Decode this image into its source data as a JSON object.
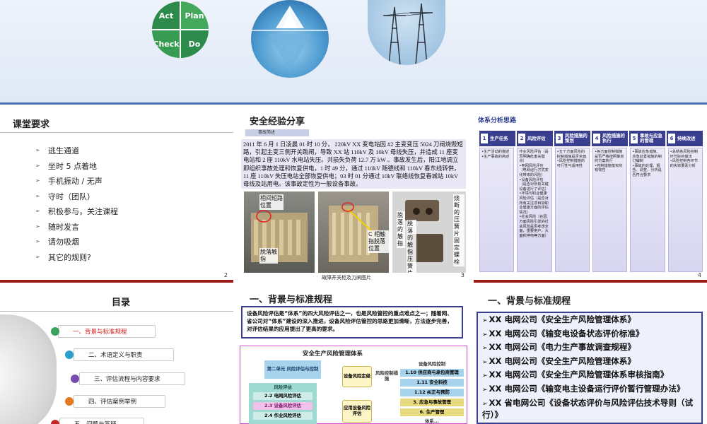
{
  "banner": {
    "pdca": {
      "act": "Act",
      "plan": "Plan",
      "check": "Check",
      "do": "Do"
    }
  },
  "slide1": {
    "title": "课堂要求",
    "items": [
      "逃生通道",
      "坐时 5 点着地",
      "手机振动 / 无声",
      "守时（团队）",
      "积极参与，关注课程",
      "随时发言",
      "请勿吸烟",
      "其它的规则?"
    ],
    "page": "2"
  },
  "slide2": {
    "title": "安全经验分享",
    "tag": "事故简述",
    "story": "2011 年 6 月 1 日凌晨 01 时 10 分， 220kV XX 变电站因 #2 主变变压 5024 刀闸烧毁短路，引起主变三侧开关跳闸，导致 XX 站 110kV 及 10kV 母线失压，并造成 11 座变电站和 2 座 110kV 水电站失压。共损失负荷 12.7 万 kW 。事故发生后，阳江地调立即组织事故处理和恢复供电，1 时 49 分，通过 110kV 随德线和 110kV 春东线转供， 11 座 110kV 失压电站全部恢复供电；03 时 01 分通过 10kV 联络线恢复春城站 10kV 母线及站用电。该事故定性为一般设备事故。",
    "photo_labels": {
      "a1": "相间短路位置",
      "a2": "脱落触指",
      "b1": "C 相触指脱落位置",
      "c1": "烧断的压簧片固定螺栓",
      "c2": "脱落的触指",
      "c3": "脱落的触指压簧片"
    },
    "caption": "故障开关柜及刀闸图片",
    "page": "3"
  },
  "slide3": {
    "title": "体系分析思路",
    "steps": [
      {
        "n": "1",
        "label": "生产任务"
      },
      {
        "n": "2",
        "label": "风险评估"
      },
      {
        "n": "3",
        "label": "风险措施的策划"
      },
      {
        "n": "4",
        "label": "风险措施的执行"
      },
      {
        "n": "5",
        "label": "事故与应急的管理"
      },
      {
        "n": "6",
        "label": "持续改进"
      }
    ],
    "columns": [
      "•生产活动的描述\n•生产事故的简述",
      "作业风险评估（是否明确危害关键点）\n•电网风险评估（电网运行方式变化带来的风险）\n•设备风险评估（是否对所有关键设备进行了评估）\n•环境与职业健康风险评估（是否对所有关注项目如职业健康方面的评估情况）\n•社会风险（在因方面风险引发的社会风险是否考虑全面，重要用户，大面积停电等方面）",
      "•五个方面风险的控制措施是否全面\n•风险控制措施的可行性与适用性",
      "•各方面控制措施是否严格按照策划的方案执行\n•控制措施落实的有效性",
      "•事故应急措施、应急处置措施的制订编制\n•事故的处理、报告、调查、分析是否符合要求",
      "•总结各风险控制环节好的做法\n•风险控制各环节的失效要素分析"
    ],
    "page": "4"
  },
  "slide4": {
    "title": "目录",
    "items": [
      "一、背景与标准规程",
      "二、术语定义与职责",
      "三、评估流程与内容要求",
      "四、评估案例举例",
      "五、问题与答疑"
    ],
    "dot_colors": [
      "#3aa35a",
      "#2aa0c8",
      "#7a4bb0",
      "#e07a1f",
      "#c42828"
    ]
  },
  "slide5": {
    "title": "一、背景与标准规程",
    "intro": "设备风险评估是“体系”的四大风险评估之一，也是风险管控的重点难点之一；随着网、省公司对“体系”建设的深入推进，设备风险评估管控的思路更加清晰，方法逐步完善，对评估结果的应用提出了更高的要求。",
    "diagram": {
      "title": "安全生产风险管理体系",
      "unit2": "第二单元 风险评估与控制",
      "risk_eval": "风险评估",
      "r22": "2.2 电网风险评估",
      "r23": "2.3 设备风险评估",
      "r24": "2.4 作业风险评估",
      "device_level": "设备风险定级",
      "risk_ctrl_measure": "风险控制措施",
      "apply": "应用设备风险评估",
      "ctrl_head": "设备风险控制",
      "c110": "1.10 供应商与承包商管理",
      "c111": "1.11 安全科技",
      "c112": "1.12 纠正与预防",
      "c3": "3. 应急与事故管理",
      "c6": "6. 生产管理",
      "more": "体系..."
    }
  },
  "slide6": {
    "title": "一、背景与标准规程",
    "items": [
      "XX 电网公司《安全生产风险管理体系》",
      "XX 电网公司《输变电设备状态评价标准》",
      "XX 电网公司《电力生产事故调查规程》",
      "XX 电网公司《安全生产风险管理体系》",
      "XX 电网公司《安全生产风险管理体系审核指南》",
      "XX 电网公司《输变电主设备运行评价暂行管理办法》",
      "XX 省电网公司《设备状态评价与风险评估技术导则（试行）》"
    ]
  }
}
